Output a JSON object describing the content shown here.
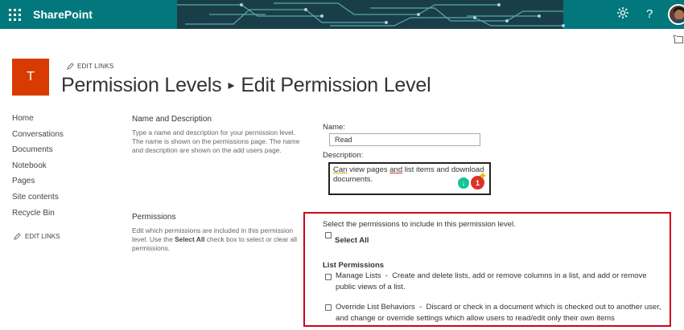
{
  "suitebar": {
    "brand": "SharePoint",
    "settings_icon": "gear-icon",
    "help_icon": "question-icon",
    "colors": {
      "background": "#03787c",
      "circuit": "#1f2f3a"
    }
  },
  "site": {
    "logo_letter": "T",
    "logo_color": "#d83b01",
    "edit_links": "EDIT LINKS"
  },
  "page": {
    "title_part1": "Permission Levels",
    "title_separator": "▸",
    "title_part2": "Edit Permission Level"
  },
  "leftnav": {
    "items": [
      {
        "label": "Home"
      },
      {
        "label": "Conversations"
      },
      {
        "label": "Documents"
      },
      {
        "label": "Notebook"
      },
      {
        "label": "Pages"
      },
      {
        "label": "Site contents"
      },
      {
        "label": "Recycle Bin"
      }
    ],
    "edit_links": "EDIT LINKS"
  },
  "name_section": {
    "title": "Name and Description",
    "desc": "Type a name and description for your permission level. The name is shown on the permissions page. The name and description are shown on the add users page.",
    "name_label": "Name:",
    "name_value": "Read",
    "description_label": "Description:",
    "description_text_1": "Can",
    "description_text_2": " view pages ",
    "description_text_3": "and",
    "description_text_4": " list items and download documents.",
    "grammarly_icon": "grammarly-icon",
    "notification_count": "1"
  },
  "permissions_section": {
    "title": "Permissions",
    "desc_1": "Edit which permissions are included in this permission level. Use the ",
    "desc_bold": "Select All",
    "desc_2": " check box to select or clear all permissions.",
    "intro": "Select the permissions to include in this permission level.",
    "select_all": "Select All",
    "list_permissions_header": "List Permissions",
    "items": [
      {
        "name": "Manage Lists",
        "description": "Create and delete lists, add or remove columns in a list, and add or remove public views of a list.",
        "checked": false
      },
      {
        "name": "Override List Behaviors",
        "description": "Discard or check in a document which is checked out to another user, and change or override settings which allow users to read/edit only their own items",
        "checked": false
      }
    ],
    "highlight_color": "#d0021b"
  }
}
